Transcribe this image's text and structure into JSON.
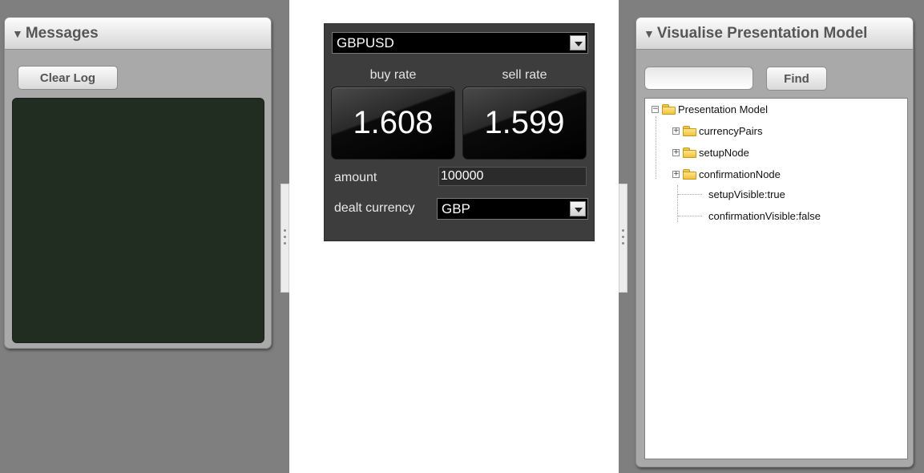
{
  "messages_panel": {
    "title": "Messages",
    "clear_button": "Clear Log"
  },
  "trade_widget": {
    "currency_pair": "GBPUSD",
    "buy": {
      "label": "buy rate",
      "rate": "1.608"
    },
    "sell": {
      "label": "sell rate",
      "rate": "1.599"
    },
    "amount_label": "amount",
    "amount_value": "100000",
    "dealt_currency_label": "dealt currency",
    "dealt_currency_value": "GBP"
  },
  "viz_panel": {
    "title": "Visualise Presentation Model",
    "search_value": "",
    "find_button": "Find",
    "tree": {
      "root": "Presentation Model",
      "folders": [
        "currencyPairs",
        "setupNode",
        "confirmationNode"
      ],
      "leaves": [
        "setupVisible:true",
        "confirmationVisible:false"
      ]
    }
  },
  "colors": {
    "side_background": "#7f7f7f",
    "panel_background": "#a9a9a9",
    "log_background": "#222d21",
    "widget_background": "#3d3d3d"
  }
}
